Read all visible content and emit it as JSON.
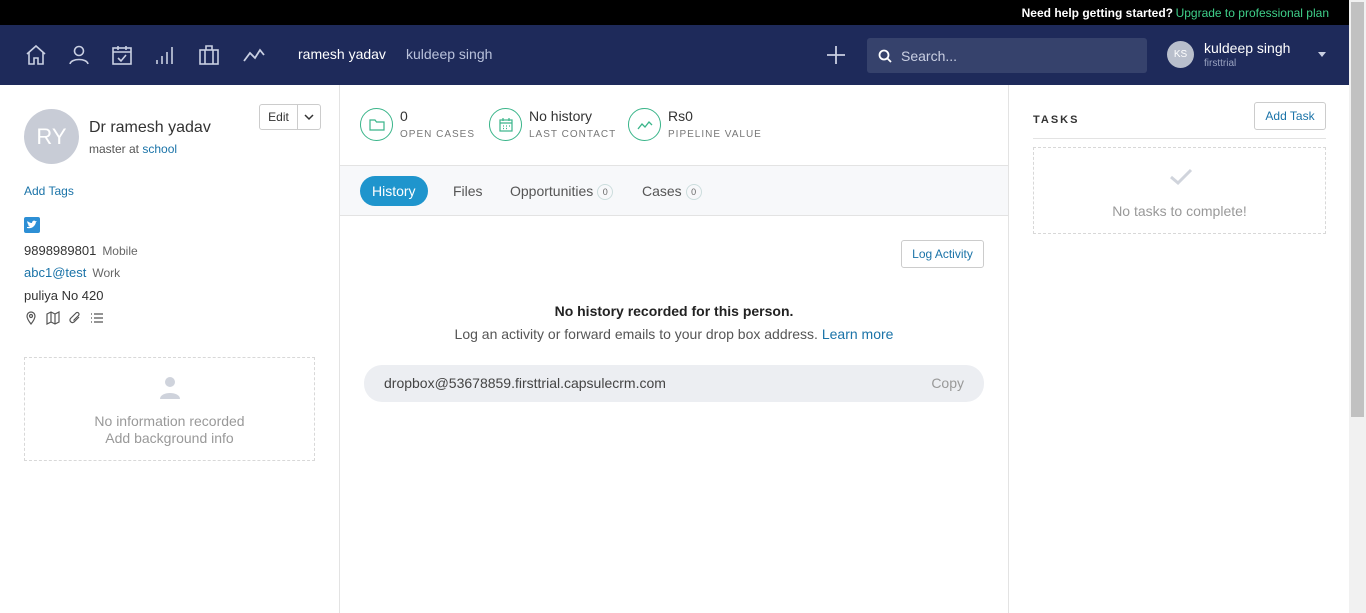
{
  "promo": {
    "help": "Need help getting started?",
    "upgrade": "Upgrade to professional plan"
  },
  "nav": {
    "icons": [
      "home-icon",
      "person-icon",
      "calendar-check-icon",
      "signal-bars-icon",
      "briefcase-icon",
      "trend-line-icon"
    ],
    "recent1": "ramesh yadav",
    "recent2": "kuldeep singh",
    "search_placeholder": "Search...",
    "user": {
      "initials": "KS",
      "name": "kuldeep singh",
      "account": "firsttrial"
    }
  },
  "person": {
    "initials": "RY",
    "name": "Dr ramesh yadav",
    "title_prefix": "master at ",
    "org": "school",
    "edit_label": "Edit",
    "add_tags": "Add Tags",
    "phone": "9898989801",
    "phone_type": "Mobile",
    "email": "abc1@test",
    "email_type": "Work",
    "address": "puliya No 420",
    "background_empty": "No information recorded",
    "background_add": "Add background info"
  },
  "stats": [
    {
      "value": "0",
      "label": "OPEN CASES",
      "icon": "folder-icon"
    },
    {
      "value": "No history",
      "label": "LAST CONTACT",
      "icon": "calendar-icon"
    },
    {
      "value": "Rs0",
      "label": "PIPELINE VALUE",
      "icon": "trend-icon"
    }
  ],
  "tabs": {
    "history": "History",
    "files": "Files",
    "opportunities": "Opportunities",
    "opportunities_count": "0",
    "cases": "Cases",
    "cases_count": "0"
  },
  "history": {
    "log_activity": "Log Activity",
    "empty_title": "No history recorded for this person.",
    "empty_text": "Log an activity or forward emails to your drop box address.",
    "learn_more": "Learn more",
    "dropbox": "dropbox@53678859.firsttrial.capsulecrm.com",
    "copy": "Copy"
  },
  "tasks": {
    "title": "TASKS",
    "add": "Add Task",
    "empty": "No tasks to complete!"
  }
}
